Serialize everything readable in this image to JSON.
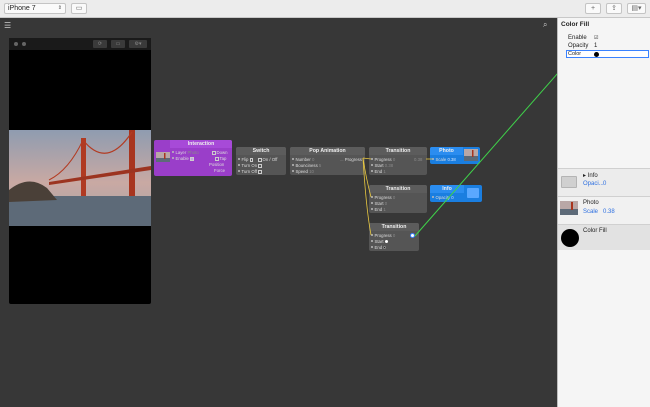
{
  "toolbar": {
    "device": "iPhone 7",
    "add_icon": "plus-icon",
    "share_icon": "share-icon",
    "view_icon": "view-menu-icon"
  },
  "viewer": {
    "rotate_icon": "rotate-icon",
    "record_icon": "record-icon",
    "settings_icon": "settings-icon"
  },
  "nodes": {
    "interaction": {
      "title": "Interaction",
      "layer_label": "Layer",
      "layer_value": "Photo",
      "enable_label": "Enable",
      "down_label": "Down",
      "tap_label": "Tap",
      "position_label": "Position",
      "force_label": "Force"
    },
    "switch": {
      "title": "Switch",
      "flip_label": "Flip",
      "on_off_label": "On / Off",
      "turn_on_label": "Turn On",
      "turn_off_label": "Turn Off"
    },
    "pop": {
      "title": "Pop Animation",
      "number_label": "Number",
      "number_value": "0",
      "bounciness_label": "Bounciness",
      "bounciness_value": "5",
      "speed_label": "Speed",
      "speed_value": "10",
      "progress_label": "Progress"
    },
    "transition1": {
      "title": "Transition",
      "progress_label": "Progress",
      "progress_value": "0",
      "start_label": "Start",
      "start_value": "0.38",
      "end_label": "End",
      "end_value": "1",
      "out_value": "0.38"
    },
    "photo": {
      "title": "Photo",
      "scale_label": "Scale",
      "scale_value": "0.38"
    },
    "transition2": {
      "title": "Transition",
      "progress_label": "Progress",
      "progress_value": "0",
      "start_label": "Start",
      "start_value": "0",
      "end_label": "End",
      "end_value": "1"
    },
    "info": {
      "title": "Info",
      "opacity_label": "Opacity",
      "opacity_value": "0"
    },
    "transition3": {
      "title": "Transition",
      "progress_label": "Progress",
      "progress_value": "0",
      "start_label": "Start",
      "end_label": "End"
    }
  },
  "sidebar": {
    "search_icon": "search-icon",
    "title": "Color Fill",
    "enable_label": "Enable",
    "opacity_label": "Opacity",
    "opacity_value": "1",
    "color_label": "Color",
    "layers": [
      {
        "name": "Info",
        "prop": "Opaci...",
        "value": "0"
      },
      {
        "name": "Photo",
        "prop": "Scale",
        "value": "0.38"
      },
      {
        "name": "Color Fill"
      }
    ]
  },
  "colors": {
    "accent_blue": "#1a7ee0",
    "interaction_purple": "#9a3ec9",
    "wire_green": "#3fd24a",
    "wire_yellow": "#e8c840"
  }
}
